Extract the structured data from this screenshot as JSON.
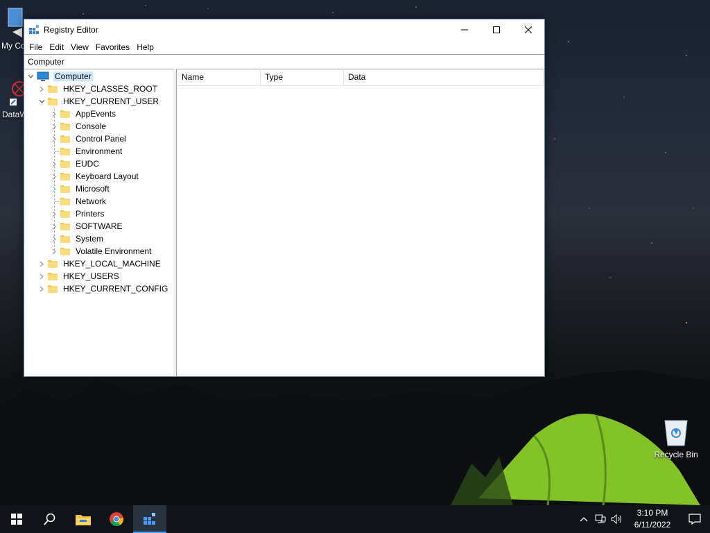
{
  "desktop": {
    "icons": [
      {
        "label": "My Co"
      },
      {
        "label": "DataW"
      },
      {
        "label": "Recycle Bin"
      }
    ]
  },
  "window": {
    "title": "Registry Editor",
    "menu": [
      "File",
      "Edit",
      "View",
      "Help",
      "Favorites"
    ],
    "address": "Computer",
    "columns": [
      "Name",
      "Type",
      "Data"
    ],
    "tree": {
      "root": "Computer",
      "hives": [
        "HKEY_CLASSES_ROOT",
        "HKEY_CURRENT_USER",
        "HKEY_LOCAL_MACHINE",
        "HKEY_USERS",
        "HKEY_CURRENT_CONFIG"
      ],
      "hkcu_children": [
        "AppEvents",
        "Console",
        "Control Panel",
        "Environment",
        "EUDC",
        "Keyboard Layout",
        "Microsoft",
        "Network",
        "Printers",
        "SOFTWARE",
        "System",
        "Volatile Environment"
      ]
    }
  },
  "taskbar": {
    "time": "3:10 PM",
    "date": "6/11/2022"
  },
  "colors": {
    "selection": "#cce8ff",
    "taskbar": "#101418",
    "accent": "#4aa3ff",
    "folder": "#f5d56b"
  }
}
